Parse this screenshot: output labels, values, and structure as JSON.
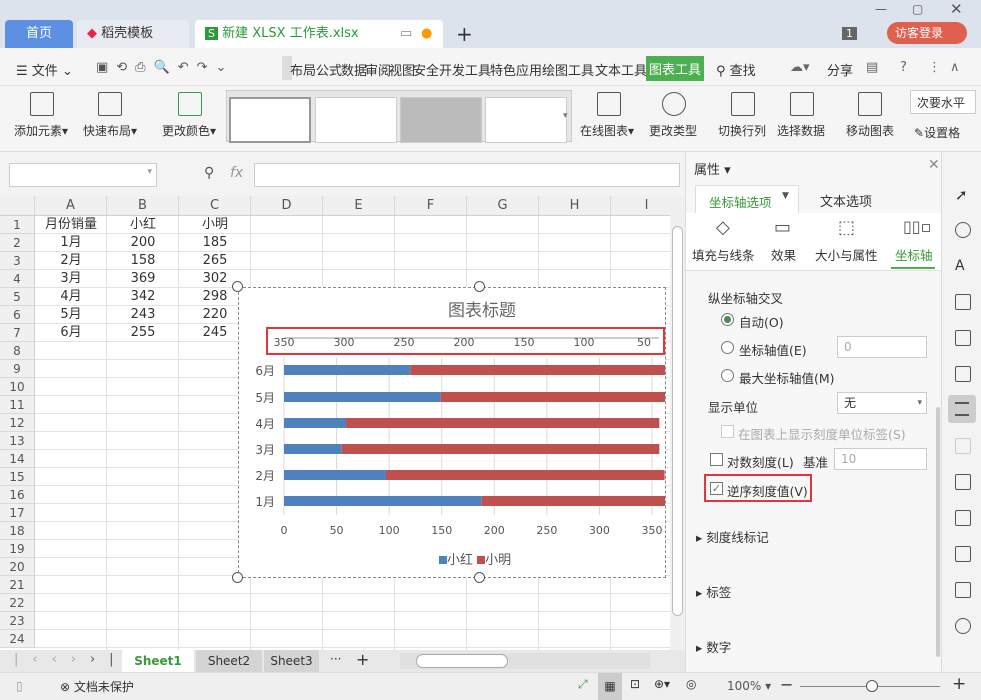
{
  "tabs": [
    {
      "label": "首页"
    },
    {
      "label": "稻壳模板"
    },
    {
      "label": "新建 XLSX 工作表.xlsx"
    }
  ],
  "tabbar": {
    "page_count": "1",
    "login": "访客登录"
  },
  "menu": {
    "items": [
      "文件",
      "布局",
      "公式",
      "数据",
      "审阅",
      "视图",
      "安全",
      "开发工具",
      "特色应用",
      "绘图工具",
      "文本工具",
      "图表工具"
    ],
    "search": "查找",
    "share": "分享"
  },
  "ribbon": {
    "add_element": "添加元素",
    "quick_layout": "快速布局",
    "change_color": "更改颜色",
    "online_chart": "在线图表",
    "change_type": "更改类型",
    "switch_row_col": "切换行列",
    "select_data": "选择数据",
    "move_chart": "移动图表",
    "secondary": "次要水平",
    "settings": "设置格"
  },
  "formula": {
    "fx": "fx",
    "name_box": ""
  },
  "grid": {
    "columns": [
      "A",
      "B",
      "C",
      "D",
      "E",
      "F",
      "G",
      "H",
      "I"
    ],
    "rows": [
      "1",
      "2",
      "3",
      "4",
      "5",
      "6",
      "7",
      "8",
      "9",
      "10",
      "11",
      "12",
      "13",
      "14",
      "15",
      "16",
      "17",
      "18",
      "19",
      "20",
      "21",
      "22",
      "23",
      "24"
    ],
    "cells": [
      [
        "月份销量",
        "小红",
        "小明"
      ],
      [
        "1月",
        "200",
        "185"
      ],
      [
        "2月",
        "158",
        "265"
      ],
      [
        "3月",
        "369",
        "302"
      ],
      [
        "4月",
        "342",
        "298"
      ],
      [
        "5月",
        "243",
        "220"
      ],
      [
        "6月",
        "255",
        "245"
      ]
    ]
  },
  "chart_data": {
    "type": "bar",
    "stacked": true,
    "title": "图表标题",
    "categories": [
      "1月",
      "2月",
      "3月",
      "4月",
      "5月",
      "6月"
    ],
    "series": [
      {
        "name": "小红",
        "color": "#4f81bd",
        "values": [
          188,
          97,
          55,
          59,
          149,
          120
        ]
      },
      {
        "name": "小明",
        "color": "#c0504d",
        "values": [
          185,
          265,
          302,
          298,
          220,
          245
        ]
      }
    ],
    "x_ticks": [
      "0",
      "50",
      "100",
      "150",
      "200",
      "250",
      "300",
      "350"
    ],
    "secondary_ticks": [
      "350",
      "300",
      "250",
      "200",
      "150",
      "100",
      "50"
    ],
    "xlim": [
      0,
      350
    ],
    "legend": "bottom"
  },
  "panel": {
    "title": "属性",
    "tab_axis": "坐标轴选项",
    "tab_text": "文本选项",
    "subtabs": [
      "填充与线条",
      "效果",
      "大小与属性",
      "坐标轴"
    ],
    "cross_label": "纵坐标轴交叉",
    "auto": "自动(O)",
    "axis_value": "坐标轴值(E)",
    "axis_value_input": "0",
    "max_value": "最大坐标轴值(M)",
    "display_unit": "显示单位",
    "display_unit_value": "无",
    "show_unit_label": "在图表上显示刻度单位标签(S)",
    "log_scale": "对数刻度(L)",
    "base": "基准",
    "base_value": "10",
    "reverse": "逆序刻度值(V)",
    "tick_marks": "刻度线标记",
    "labels": "标签",
    "number": "数字"
  },
  "sheets": [
    "Sheet1",
    "Sheet2",
    "Sheet3"
  ],
  "status": {
    "protect": "文档未保护",
    "zoom": "100%"
  },
  "colors": {
    "accent": "#4caf50",
    "blue": "#4f81bd",
    "red": "#c0504d",
    "highlight": "#e8333a"
  }
}
